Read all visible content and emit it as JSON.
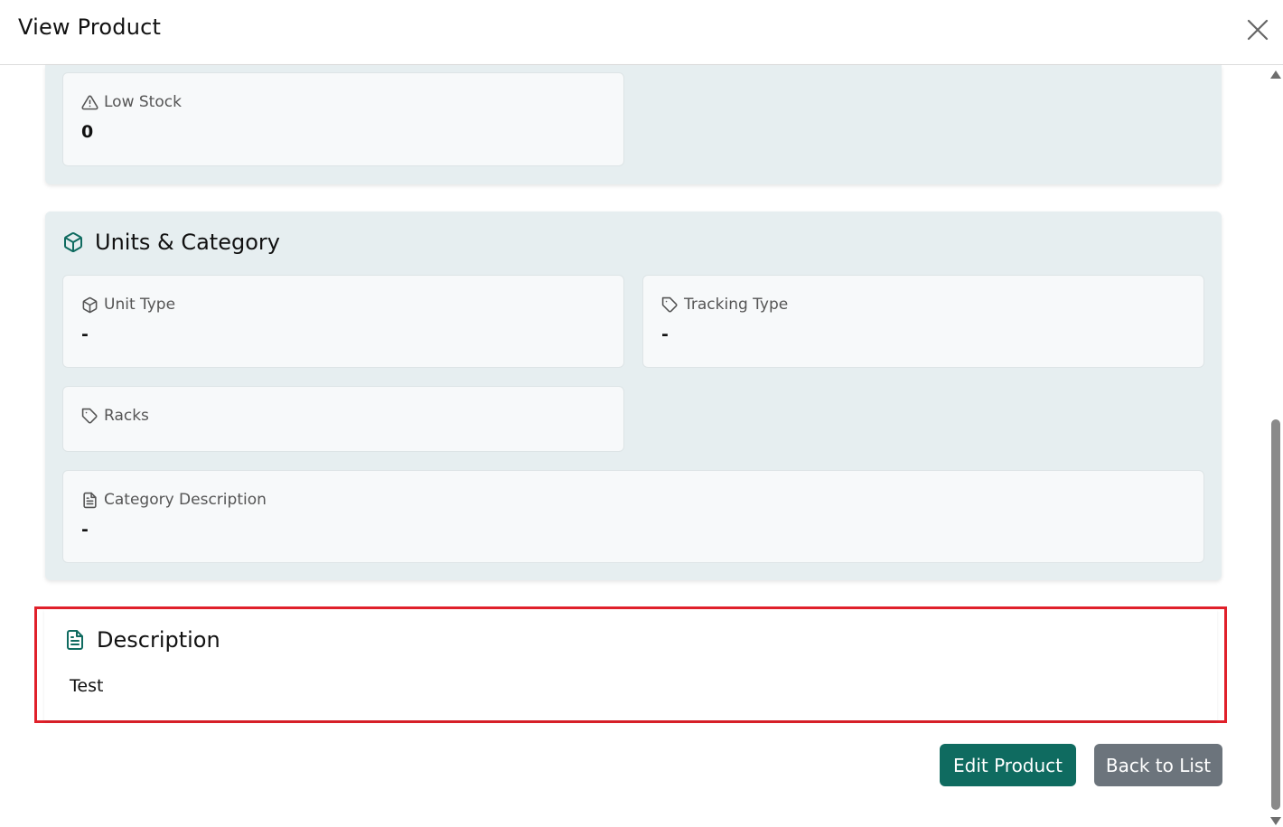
{
  "header": {
    "title": "View Product",
    "close_icon": "close-icon"
  },
  "stock_section": {
    "low_stock": {
      "label": "Low Stock",
      "value": "0",
      "icon": "alert-triangle-icon"
    }
  },
  "units_section": {
    "title": "Units & Category",
    "icon": "box-icon",
    "unit_type": {
      "label": "Unit Type",
      "value": "-",
      "icon": "box-icon"
    },
    "tracking_type": {
      "label": "Tracking Type",
      "value": "-",
      "icon": "tag-icon"
    },
    "racks": {
      "label": "Racks",
      "value": "",
      "icon": "tag-icon"
    },
    "category_description": {
      "label": "Category Description",
      "value": "-",
      "icon": "file-text-icon"
    }
  },
  "description_section": {
    "title": "Description",
    "icon": "file-text-icon",
    "text": "Test",
    "highlight_color": "#e0202a"
  },
  "actions": {
    "edit_label": "Edit Product",
    "back_label": "Back to List"
  },
  "colors": {
    "accent": "#0f6b60",
    "secondary": "#6c747c",
    "section_bg": "#e6eef0"
  }
}
